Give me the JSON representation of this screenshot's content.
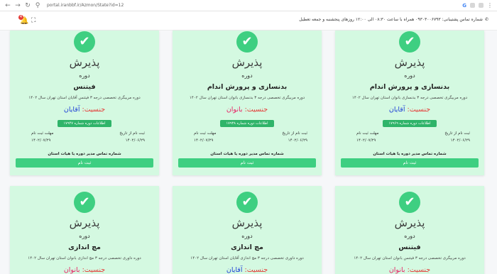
{
  "browser": {
    "url": "portal.iranbbf.ir/Azmon/State?id=12",
    "nav": {
      "back": "←",
      "forward": "→",
      "reload": "↻",
      "lock": "⚲"
    },
    "ext": "G",
    "menu": "⋮"
  },
  "header": {
    "contact_text": "شماره تماس پشتیبانی: ۰۹۳۰۳۰۰۶۷۹۳ همراه با ساعت ۰۸:۳۰ الی ۱۲:۰۰ روزهای پنجشنبه و جمعه تعطیل",
    "contact_icon": "✆",
    "notif_count": "4",
    "bell_icon": "🔔",
    "fullscreen_icon": "⛶"
  },
  "cards": [
    {
      "check": "✔",
      "status": "پذیرش",
      "course_word": "دوره",
      "course_name": "بدنسازی و پرورش اندام",
      "description": "دوره مربیگری تخصصی درجه ۳ بدنسازی بانوان استان تهران سال ۱۴۰۲",
      "gender_label": "جنسیت:",
      "gender_value": "آقایان",
      "info_button": "اطلاعات دوره شماره ۱۷۹۶۹",
      "start_label": "ثبت نام از تاریخ",
      "start_date": "۱۴۰۲/۰۶/۲۹",
      "end_label": "مهلت ثبت نام",
      "end_date": "۱۴۰۲/۰۷/۲۹",
      "director_text": "شماره تماس مدیر دوره یا هیات استان",
      "register_label": "ثبت نام"
    },
    {
      "check": "✔",
      "status": "پذیرش",
      "course_word": "دوره",
      "course_name": "بدنسازی و پرورش اندام",
      "description": "دوره مربیگری تخصصی درجه ۳ بدنسازی بانوان استان تهران سال ۱۴۰۲",
      "gender_label": "جنسیت:",
      "gender_value": "بانوان",
      "info_button": "اطلاعات دوره شماره ۱۷۹۳۸",
      "start_label": "ثبت نام از تاریخ",
      "start_date": "۱۴۰۲/۰۶/۲۹",
      "end_label": "مهلت ثبت نام",
      "end_date": "۱۴۰۲/۰۷/۲۹",
      "director_text": "شماره تماس مدیر دوره یا هیات استان",
      "register_label": "ثبت نام"
    },
    {
      "check": "✔",
      "status": "پذیرش",
      "course_word": "دوره",
      "course_name": "فیتنس",
      "description": "دوره مربیگری تخصصی درجه ۳ فیتنس آقایان استان تهران سال ۱۴۰۲",
      "gender_label": "جنسیت:",
      "gender_value": "آقایان",
      "info_button": "اطلاعات دوره شماره ۱۷۹۴۷",
      "start_label": "ثبت نام از تاریخ",
      "start_date": "۱۴۰۲/۰۶/۲۹",
      "end_label": "مهلت ثبت نام",
      "end_date": "۱۴۰۲/۰۷/۲۹",
      "director_text": "شماره تماس مدیر دوره یا هیات استان",
      "register_label": "ثبت نام"
    },
    {
      "check": "✔",
      "status": "پذیرش",
      "course_word": "دوره",
      "course_name": "فیتنس",
      "description": "دوره مربیگری تخصصی درجه ۳ فیتنس بانوان استان تهران سال ۱۴۰۲",
      "gender_label": "جنسیت:",
      "gender_value": "بانوان"
    },
    {
      "check": "✔",
      "status": "پذیرش",
      "course_word": "دوره",
      "course_name": "مچ اندازی",
      "description": "دوره داوری تخصصی درجه ۳ مچ اندازی آقایان استان تهران سال ۱۴۰۲",
      "gender_label": "جنسیت:",
      "gender_value": "آقایان"
    },
    {
      "check": "✔",
      "status": "پذیرش",
      "course_word": "دوره",
      "course_name": "مچ اندازی",
      "description": "دوره داوری تخصصی درجه ۳ مچ اندازی بانوان استان تهران سال ۱۴۰۲",
      "gender_label": "جنسیت:",
      "gender_value": "بانوان"
    }
  ]
}
